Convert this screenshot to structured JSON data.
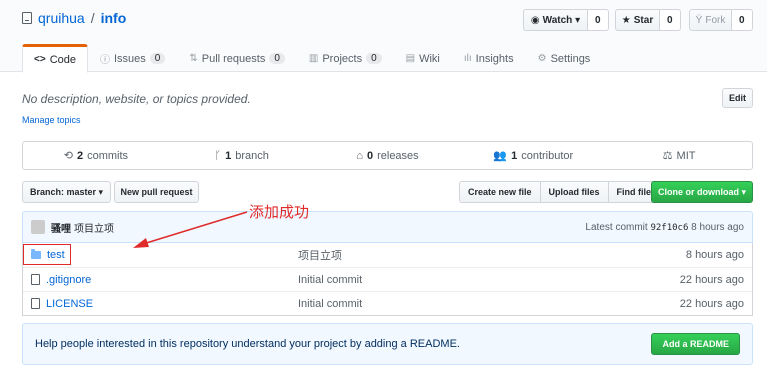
{
  "repo": {
    "owner": "qruihua",
    "separator": "/",
    "name": "info"
  },
  "actions": {
    "watch": {
      "label": "Watch ▾",
      "count": "0"
    },
    "star": {
      "label": "Star",
      "count": "0"
    },
    "fork": {
      "label": "Fork",
      "count": "0"
    }
  },
  "tabs": [
    {
      "icon": "<>",
      "label": "Code",
      "counter": ""
    },
    {
      "icon": "ⓘ",
      "label": "Issues",
      "counter": "0"
    },
    {
      "icon": "⇅",
      "label": "Pull requests",
      "counter": "0"
    },
    {
      "icon": "▥",
      "label": "Projects",
      "counter": "0"
    },
    {
      "icon": "▤",
      "label": "Wiki",
      "counter": ""
    },
    {
      "icon": "ılı",
      "label": "Insights",
      "counter": ""
    },
    {
      "icon": "⚙",
      "label": "Settings",
      "counter": ""
    }
  ],
  "description": "No description, website, or topics provided.",
  "manage_topics": "Manage topics",
  "edit_label": "Edit",
  "summary": [
    {
      "icon": "⟲",
      "number": "2",
      "label": "commits"
    },
    {
      "icon": "ᚴ",
      "number": "1",
      "label": "branch"
    },
    {
      "icon": "⌂",
      "number": "0",
      "label": "releases"
    },
    {
      "icon": "👥",
      "number": "1",
      "label": "contributor"
    },
    {
      "icon": "⚖",
      "number": "",
      "label": "MIT"
    }
  ],
  "toolbar": {
    "branch": "Branch: master ▾",
    "new_pr": "New pull request",
    "create_file": "Create new file",
    "upload": "Upload files",
    "find": "Find file",
    "clone": "Clone or download ▾"
  },
  "commit": {
    "author": "骚哩",
    "message": "项目立项",
    "latest_label": "Latest commit",
    "sha": "92f10c6",
    "time": "8 hours ago"
  },
  "files": [
    {
      "type": "folder",
      "name": "test",
      "message": "项目立项",
      "age": "8 hours ago"
    },
    {
      "type": "file",
      "name": ".gitignore",
      "message": "Initial commit",
      "age": "22 hours ago"
    },
    {
      "type": "file",
      "name": "LICENSE",
      "message": "Initial commit",
      "age": "22 hours ago"
    }
  ],
  "annotation": {
    "text": "添加成功",
    "color": "#e02b2b"
  },
  "readme": {
    "text": "Help people interested in this repository understand your project by adding a README.",
    "button": "Add a README"
  },
  "colors": {
    "link": "#0366d6",
    "accent_tab": "#e36209",
    "green": "#28a745"
  }
}
